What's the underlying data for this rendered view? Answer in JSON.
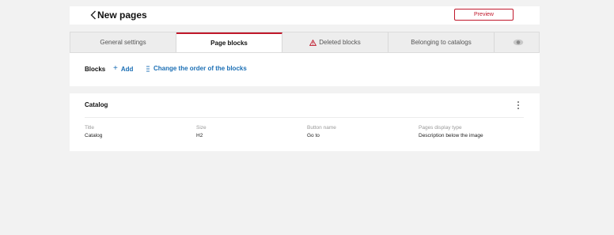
{
  "header": {
    "title": "New pages",
    "back_icon": "chevron-left-icon",
    "preview_label": "Preview"
  },
  "tabs": [
    {
      "label": "General settings",
      "active": false
    },
    {
      "label": "Page blocks",
      "active": true
    },
    {
      "label": "Deleted blocks",
      "active": false,
      "icon": "warning-icon"
    },
    {
      "label": "Belonging to catalogs",
      "active": false
    }
  ],
  "blocks_bar": {
    "label": "Blocks",
    "add_label": "Add",
    "reorder_label": "Change the order of the blocks"
  },
  "catalog_block": {
    "title": "Catalog",
    "fields": [
      {
        "label": "Title",
        "value": "Catalog"
      },
      {
        "label": "Size",
        "value": "H2"
      },
      {
        "label": "Button name",
        "value": "Go to"
      },
      {
        "label": "Pages display type",
        "value": "Description below the image"
      }
    ]
  },
  "colors": {
    "accent": "#c0182b",
    "link": "#1b6fb5",
    "background": "#f2f2f2"
  }
}
